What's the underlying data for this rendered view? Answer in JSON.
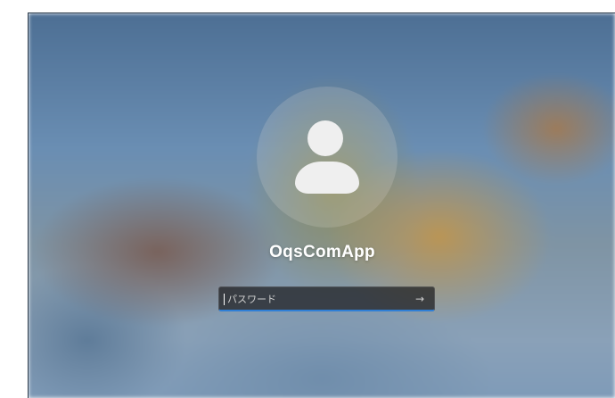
{
  "login": {
    "username": "OqsComApp",
    "password_placeholder": "パスワード",
    "password_value": "",
    "submit_glyph": "→",
    "avatar_icon": "user-avatar-icon",
    "accent_color": "#2f7fd6"
  }
}
